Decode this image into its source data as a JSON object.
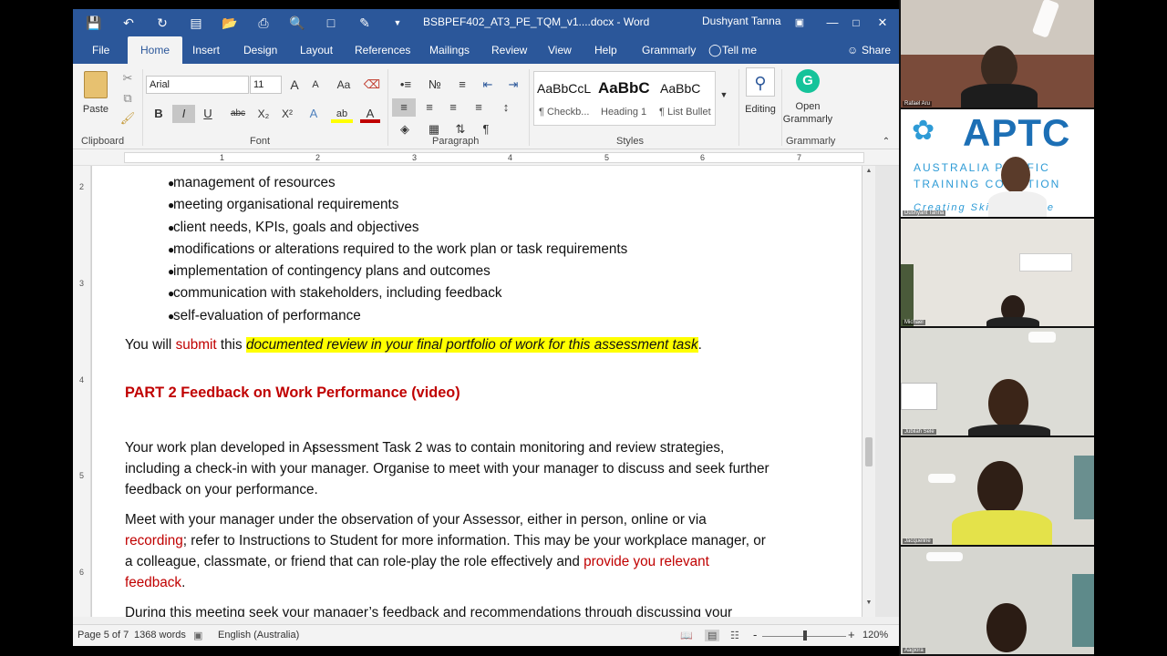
{
  "window": {
    "title": "BSBPEF402_AT3_PE_TQM_v1....docx  -  Word",
    "user": "Dushyant Tanna",
    "quick_access_icons": [
      "save-icon",
      "undo-icon",
      "redo-icon",
      "save-as-icon",
      "open-icon",
      "print-preview-icon",
      "find-icon",
      "new-icon",
      "comment-icon",
      "customize-icon"
    ]
  },
  "tabs": [
    "File",
    "Home",
    "Insert",
    "Design",
    "Layout",
    "References",
    "Mailings",
    "Review",
    "View",
    "Help",
    "Grammarly",
    "Tell me",
    "Share"
  ],
  "active_tab": "Home",
  "ribbon": {
    "clipboard": {
      "paste": "Paste",
      "label": "Clipboard"
    },
    "font": {
      "name": "Arial",
      "size": "11",
      "label": "Font",
      "aa": "Aa",
      "b": "B",
      "i": "I",
      "u": "U",
      "strike": "abc",
      "sub": "X₂",
      "sup": "X²",
      "effect": "A",
      "highlight": "ab",
      "color": "A",
      "grow": "A",
      "shrink": "A"
    },
    "paragraph": {
      "label": "Paragraph",
      "pilcrow": "¶"
    },
    "styles": {
      "label": "Styles",
      "items": [
        {
          "sample": "AaBbCcL",
          "name": "¶ Checkb..."
        },
        {
          "sample": "AaBbC",
          "name": "Heading 1"
        },
        {
          "sample": "AaBbC",
          "name": "¶ List Bullet"
        }
      ]
    },
    "editing": {
      "label": "Editing"
    },
    "grammarly": {
      "button": "Open Grammarly",
      "label": "Grammarly"
    }
  },
  "ruler": {
    "numbers": [
      "1",
      "2",
      "3",
      "4",
      "5",
      "6",
      "7"
    ]
  },
  "vruler": {
    "numbers": [
      "2",
      "3",
      "4",
      "5",
      "6"
    ]
  },
  "document": {
    "bullets": [
      "management of resources",
      "meeting organisational requirements",
      "client needs, KPIs, goals and objectives",
      "modifications or alterations required to the work plan or task requirements",
      "implementation of contingency plans and outcomes",
      "communication with stakeholders, including feedback",
      "self-evaluation of performance"
    ],
    "submit_line": {
      "pre": "You will ",
      "red": "submit",
      "mid": " this ",
      "highlight": "documented review in your final portfolio of work for this assessment task",
      "post": "."
    },
    "heading": "PART 2 Feedback on Work Performance (video)",
    "para1": [
      "Your work plan developed in Assessment Task 2 was to contain monitoring and review strategies,",
      "including a check-in with your manager. Organise to meet with your manager to discuss and seek further",
      "feedback on your performance."
    ],
    "para2": {
      "line1": "Meet with your manager under the observation of your Assessor, either in person, online or via",
      "line2_red": "recording",
      "line2_rest": "; refer to Instructions to Student for more information. This may be your workplace manager, or",
      "line3_pre": "a colleague, classmate, or friend that can role-play the role effectively and ",
      "line3_red": "provide you relevant",
      "line4_red": "feedback",
      "line4_post": "."
    },
    "cutoff_line": "During this meeting seek your manager’s feedback and recommendations through discussing your"
  },
  "status": {
    "page": "Page 5 of 7",
    "words": "1368 words",
    "language": "English (Australia)",
    "zoom": "120%",
    "zoom_minus": "-",
    "zoom_plus": "+"
  },
  "participants": [
    {
      "name": "Rafael Aru"
    },
    {
      "name": "Dushyant Tanna",
      "logo_main": "APTC",
      "logo_line1": "AUSTRALIA PACIFIC",
      "logo_line2": "TRAINING COALITION",
      "logo_tagline": "Creating Skills for Life"
    },
    {
      "name": "Michael"
    },
    {
      "name": "Jubilah Sele"
    },
    {
      "name": "Jacqueline"
    },
    {
      "name": "Aagiora"
    }
  ],
  "colors": {
    "word_blue": "#2b579a",
    "red_text": "#c00000",
    "highlight": "#ffff00",
    "aptc_blue": "#1c6fb5"
  }
}
